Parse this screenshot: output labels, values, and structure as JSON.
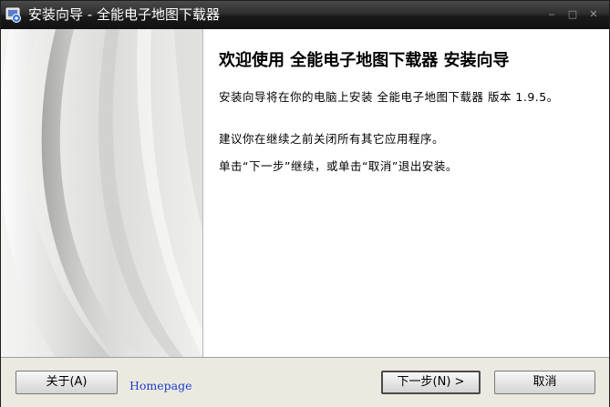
{
  "window": {
    "title": "安装向导 - 全能电子地图下载器",
    "minimize_glyph": "‒",
    "maximize_glyph": "□",
    "close_glyph": "✕"
  },
  "content": {
    "heading": "欢迎使用 全能电子地图下载器 安装向导",
    "paragraph1": "安装向导将在你的电脑上安装 全能电子地图下载器 版本 1.9.5。",
    "paragraph2": "建议你在继续之前关闭所有其它应用程序。",
    "paragraph3": "单击“下一步”继续，或单击“取消”退出安装。"
  },
  "buttons": {
    "about_label": "关于(A)",
    "next_label": "下一步(N) >",
    "cancel_label": "取消"
  },
  "links": {
    "homepage_label": "Homepage"
  },
  "icons": {
    "app": "installer-app-icon",
    "minimize": "minimize-icon",
    "maximize": "maximize-icon",
    "close": "close-icon"
  },
  "colors": {
    "titlebar": "#1a1a1a",
    "link": "#1a3ec8",
    "background": "#ece9e1"
  }
}
